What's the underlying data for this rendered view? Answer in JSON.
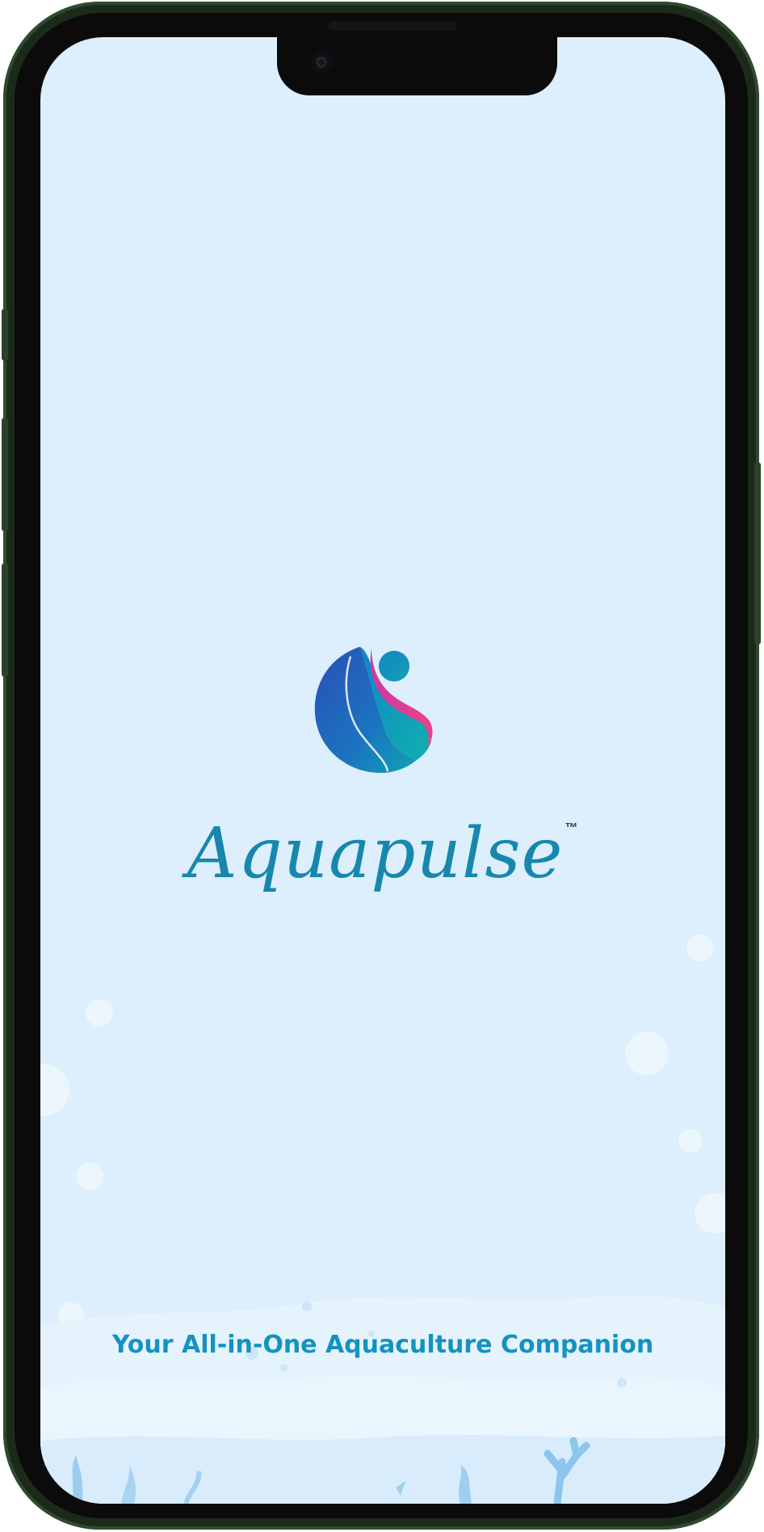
{
  "app": {
    "name": "Aquapulse",
    "trademark": "™",
    "tagline": "Your All-in-One Aquaculture Companion"
  },
  "icons": {
    "logo": "aquapulse-wave-logo-icon",
    "camera": "front-camera-icon"
  },
  "colors": {
    "background": "#ddeefc",
    "brand_text": "#1787ad",
    "tagline_text": "#1492c2",
    "logo_blue": "#1f5fb8",
    "logo_teal": "#0fa3b3",
    "logo_pink": "#e0388a",
    "device_frame": "#1c2a1c"
  }
}
